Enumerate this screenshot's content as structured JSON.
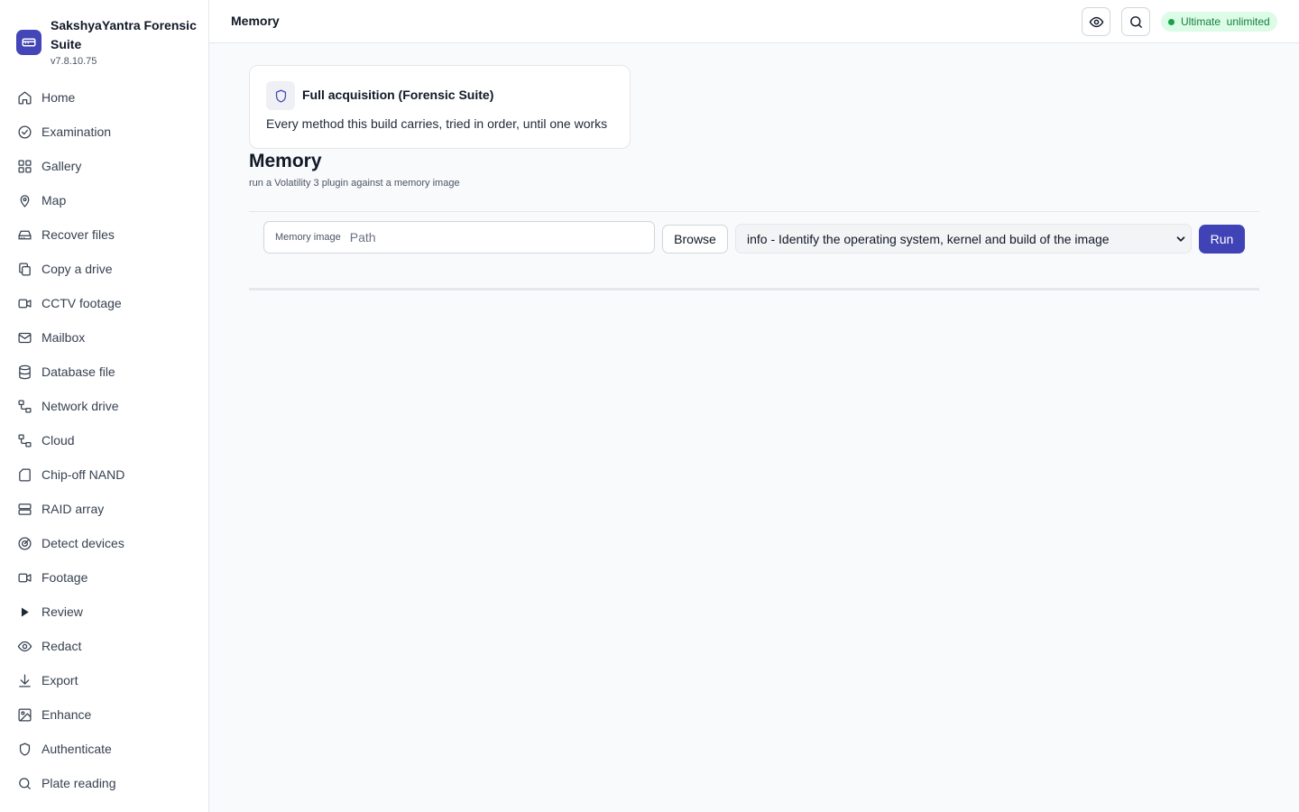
{
  "app": {
    "name": "SakshyaYantra Forensic Suite",
    "version": "v7.8.10.75",
    "logo_icon": "drive-icon",
    "accent_color": "#4446b8"
  },
  "sidebar": {
    "items": [
      {
        "label": "Home",
        "icon": "home-icon"
      },
      {
        "label": "Examination",
        "icon": "check-circle-icon"
      },
      {
        "label": "Gallery",
        "icon": "grid-icon"
      },
      {
        "label": "Map",
        "icon": "map-pin-icon"
      },
      {
        "label": "Recover files",
        "icon": "hard-drive-icon"
      },
      {
        "label": "Copy a drive",
        "icon": "copy-icon"
      },
      {
        "label": "CCTV footage",
        "icon": "video-icon"
      },
      {
        "label": "Mailbox",
        "icon": "mail-icon"
      },
      {
        "label": "Database file",
        "icon": "database-icon"
      },
      {
        "label": "Network drive",
        "icon": "network-icon"
      },
      {
        "label": "Cloud",
        "icon": "network-icon"
      },
      {
        "label": "Chip-off NAND",
        "icon": "file-icon"
      },
      {
        "label": "RAID array",
        "icon": "server-icon"
      },
      {
        "label": "Detect devices",
        "icon": "radar-icon"
      },
      {
        "label": "Footage",
        "icon": "video-icon"
      },
      {
        "label": "Review",
        "icon": "play-icon"
      },
      {
        "label": "Redact",
        "icon": "eye-icon"
      },
      {
        "label": "Export",
        "icon": "download-icon"
      },
      {
        "label": "Enhance",
        "icon": "image-icon"
      },
      {
        "label": "Authenticate",
        "icon": "shield-icon"
      },
      {
        "label": "Plate reading",
        "icon": "search-icon"
      }
    ]
  },
  "header": {
    "title": "Memory",
    "plan_badge": "Ultimate  unlimited",
    "plan_color": "#16a34a"
  },
  "acquisition_card": {
    "title": "Full acquisition (Forensic Suite)",
    "description": "Every method this build carries, tried in order, until one works",
    "icon": "shield-icon"
  },
  "section": {
    "title": "Memory",
    "subtitle": "run a Volatility 3 plugin against a memory image"
  },
  "form": {
    "path_label": "Memory image",
    "path_placeholder": "Path",
    "path_value": "",
    "browse_label": "Browse",
    "plugin_selected": "info - Identify the operating system, kernel and build of the image",
    "run_label": "Run"
  }
}
